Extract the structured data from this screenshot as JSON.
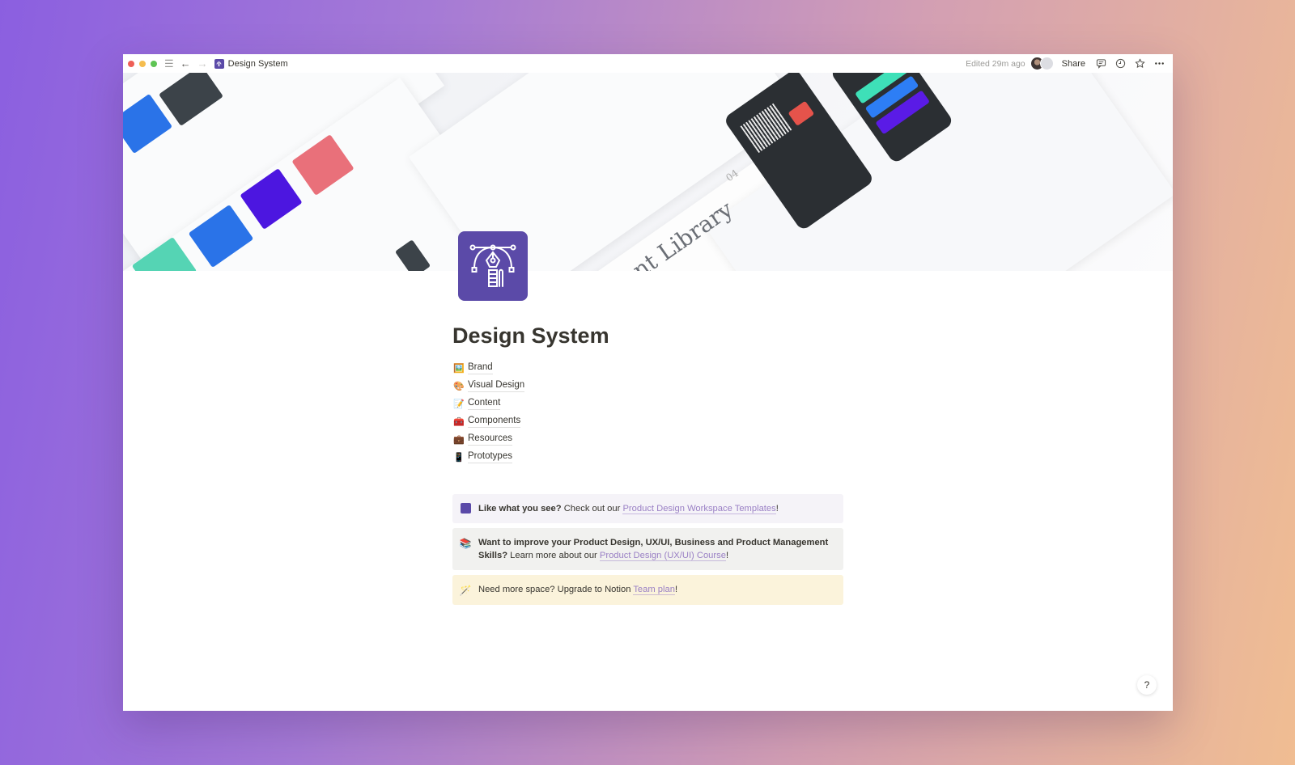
{
  "window": {
    "traffic_lights": {
      "close": "#ee5f57",
      "minimize": "#f5bd4f",
      "maximize": "#5fc454"
    },
    "accent": "#5b4aa8"
  },
  "topbar": {
    "menu_icon": "hamburger-icon",
    "back_icon": "arrow-left-icon",
    "forward_icon": "arrow-right-icon",
    "breadcrumb": "Design System",
    "edited": "Edited 29m ago",
    "share_label": "Share",
    "icons": [
      "comment-icon",
      "clock-icon",
      "star-icon",
      "more-icon"
    ]
  },
  "cover": {
    "caption_text": "nt Library",
    "number": "04"
  },
  "page": {
    "title": "Design System",
    "links": [
      {
        "emoji": "🖼️",
        "label": "Brand"
      },
      {
        "emoji": "🎨",
        "label": "Visual Design"
      },
      {
        "emoji": "📝",
        "label": "Content"
      },
      {
        "emoji": "🧰",
        "label": "Components"
      },
      {
        "emoji": "💼",
        "label": "Resources"
      },
      {
        "emoji": "📱",
        "label": "Prototypes"
      }
    ],
    "callouts": [
      {
        "bold": "Like what you see?",
        "text": " Check out our ",
        "link": "Product Design Workspace Templates",
        "after": "!"
      },
      {
        "emoji": "📚",
        "bold": "Want to improve your Product Design, UX/UI, Business and Product Management Skills?",
        "text": " Learn more about our ",
        "link": "Product Design (UX/UI) Course",
        "after": "!"
      },
      {
        "emoji": "🪄",
        "bold": "",
        "text": "Need more space? Upgrade to Notion ",
        "link": "Team plan",
        "after": "!"
      }
    ]
  },
  "help_label": "?"
}
